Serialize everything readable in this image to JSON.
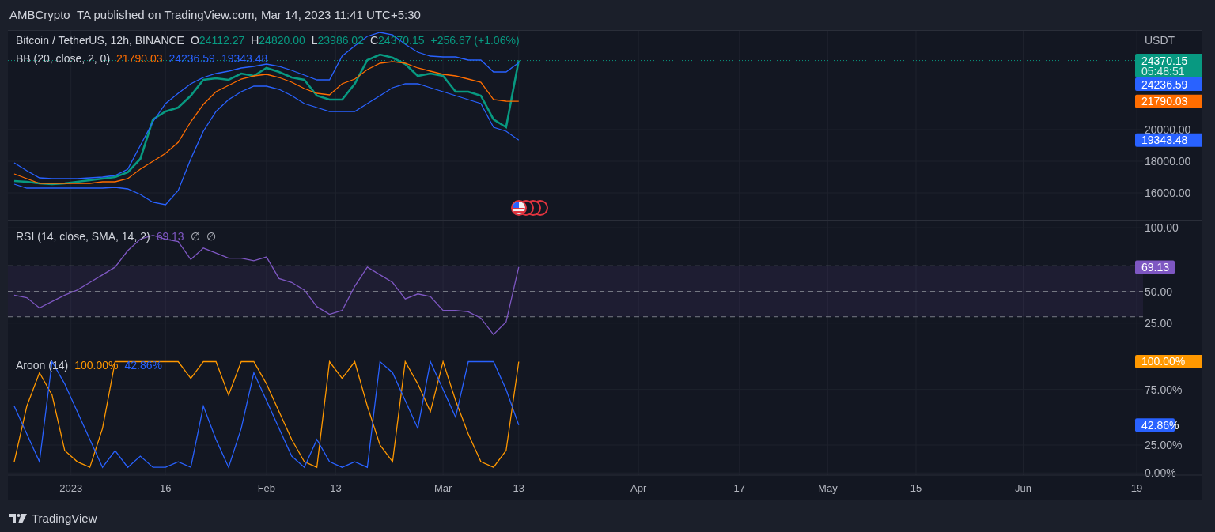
{
  "header": {
    "title": "AMBCrypto_TA published on TradingView.com, Mar 14, 2023 11:41 UTC+5:30"
  },
  "price_pane": {
    "legend": {
      "symbol": "Bitcoin / TetherUS, 12h, BINANCE",
      "ohlc": [
        {
          "label": "O",
          "value": "24112.27"
        },
        {
          "label": "H",
          "value": "24820.00"
        },
        {
          "label": "L",
          "value": "23986.02"
        },
        {
          "label": "C",
          "value": "24370.15"
        }
      ],
      "change": "+256.67 (+1.06%)"
    },
    "indicator_legend": {
      "name": "BB (20, close, 2, 0)",
      "values": [
        {
          "text": "21790.03",
          "color": "#ff6d00"
        },
        {
          "text": "24236.59",
          "color": "#2962ff"
        },
        {
          "text": "19343.48",
          "color": "#2962ff"
        }
      ]
    },
    "axis_unit": "USDT",
    "price_labels": [
      {
        "text": "24370.15",
        "note": "05:48:51"
      },
      {
        "text": "24236.59"
      },
      {
        "text": "21790.03"
      },
      {
        "text": "19343.48"
      }
    ],
    "chart_data": {
      "type": "line",
      "grid": true,
      "categories": [
        null,
        null,
        null,
        null,
        null,
        null,
        null,
        null,
        null,
        null,
        null,
        null,
        null,
        null,
        null,
        null,
        null,
        null,
        null,
        null,
        null,
        null,
        null,
        null,
        null,
        null,
        null,
        null,
        null,
        null,
        null,
        null,
        null,
        null,
        null,
        null,
        null,
        null,
        null,
        null,
        null,
        null,
        null,
        null,
        null,
        null,
        null,
        null,
        null,
        null,
        null,
        null,
        null,
        null,
        null,
        null,
        null,
        null,
        null,
        null,
        null,
        null,
        null,
        null,
        null,
        null,
        null,
        null,
        null,
        null,
        null,
        null,
        null,
        null,
        null,
        null,
        null,
        null,
        null,
        null,
        null,
        null,
        null,
        null,
        null,
        null,
        null,
        null,
        null,
        null
      ],
      "ylim": [
        14300,
        26250
      ],
      "series": [
        {
          "color": "#089981",
          "values": [
            16750,
            16700,
            16600,
            16550,
            16600,
            16700,
            16800,
            16900,
            17000,
            17300,
            18150,
            20650,
            21150,
            21400,
            22150,
            23150,
            23250,
            23150,
            23550,
            23400,
            23900,
            23650,
            23300,
            23150,
            22150,
            21900,
            21900,
            22900,
            24400,
            24750,
            24550,
            24150,
            23400,
            23550,
            23400,
            22400,
            22400,
            22150,
            20650,
            20150,
            24370,
            null,
            null,
            null,
            null,
            null,
            null,
            null,
            null,
            null,
            null,
            null,
            null,
            null,
            null,
            null,
            null,
            null,
            null,
            null,
            null,
            null,
            null,
            null,
            null,
            null,
            null,
            null,
            null,
            null,
            null,
            null,
            null,
            null,
            null,
            null,
            null,
            null,
            null,
            null,
            null,
            null,
            null,
            null,
            null,
            null,
            null,
            null,
            null,
            null
          ]
        },
        {
          "color": "#2962ff",
          "values": [
            17900,
            17400,
            16950,
            16900,
            16900,
            16900,
            16950,
            17000,
            17100,
            17500,
            19000,
            20500,
            21650,
            22300,
            22900,
            23300,
            23550,
            23700,
            23900,
            24000,
            24150,
            24000,
            23750,
            23450,
            23150,
            23150,
            24650,
            25300,
            25900,
            26150,
            26000,
            25400,
            24900,
            24650,
            24600,
            24600,
            24400,
            24400,
            23650,
            23650,
            24240,
            null,
            null,
            null,
            null,
            null,
            null,
            null,
            null,
            null,
            null,
            null,
            null,
            null,
            null,
            null,
            null,
            null,
            null,
            null,
            null,
            null,
            null,
            null,
            null,
            null,
            null,
            null,
            null,
            null,
            null,
            null,
            null,
            null,
            null,
            null,
            null,
            null,
            null,
            null,
            null,
            null,
            null,
            null,
            null,
            null,
            null,
            null,
            null,
            null
          ]
        },
        {
          "color": "#ff6d00",
          "values": [
            17200,
            16900,
            16600,
            16600,
            16600,
            16600,
            16600,
            16700,
            16700,
            16900,
            17500,
            18000,
            18500,
            19200,
            20500,
            21600,
            22400,
            22800,
            23200,
            23400,
            23500,
            23300,
            23000,
            22600,
            22300,
            22200,
            22900,
            23200,
            23800,
            24200,
            24300,
            24200,
            23900,
            23700,
            23500,
            23400,
            23200,
            23000,
            21900,
            21800,
            21790,
            null,
            null,
            null,
            null,
            null,
            null,
            null,
            null,
            null,
            null,
            null,
            null,
            null,
            null,
            null,
            null,
            null,
            null,
            null,
            null,
            null,
            null,
            null,
            null,
            null,
            null,
            null,
            null,
            null,
            null,
            null,
            null,
            null,
            null,
            null,
            null,
            null,
            null,
            null,
            null,
            null,
            null,
            null,
            null,
            null,
            null,
            null,
            null,
            null
          ]
        },
        {
          "color": "#2962ff",
          "values": [
            16550,
            16300,
            16300,
            16300,
            16300,
            16300,
            16300,
            16300,
            16350,
            16250,
            15900,
            15400,
            15250,
            16150,
            18150,
            19900,
            21150,
            21900,
            22400,
            22750,
            22750,
            22550,
            22150,
            21650,
            21400,
            21150,
            21150,
            21150,
            21650,
            22150,
            22650,
            22900,
            22900,
            22650,
            22400,
            22150,
            21900,
            21650,
            20150,
            19900,
            19340,
            null,
            null,
            null,
            null,
            null,
            null,
            null,
            null,
            null,
            null,
            null,
            null,
            null,
            null,
            null,
            null,
            null,
            null,
            null,
            null,
            null,
            null,
            null,
            null,
            null,
            null,
            null,
            null,
            null,
            null,
            null,
            null,
            null,
            null,
            null,
            null,
            null,
            null,
            null,
            null,
            null,
            null,
            null,
            null,
            null,
            null,
            null,
            null,
            null
          ]
        }
      ],
      "yticks": [
        {
          "value": 20000,
          "label": "20000.00"
        },
        {
          "value": 18000,
          "label": "18000.00"
        },
        {
          "value": 16000,
          "label": "16000.00"
        }
      ],
      "ref_lines": [
        {
          "axis": "y",
          "value": 24370,
          "color": "#089981"
        }
      ]
    }
  },
  "rsi_pane": {
    "legend": {
      "name": "RSI (14, close, SMA, 14, 2)",
      "values": [
        {
          "text": "69.13",
          "color": "#7e57c2"
        }
      ],
      "extras": [
        "∅",
        "∅"
      ]
    },
    "price_labels": [
      {
        "text": "69.13"
      }
    ],
    "chart_data": {
      "type": "line",
      "grid": true,
      "categories": [
        null,
        null,
        null,
        null,
        null,
        null,
        null,
        null,
        null,
        null,
        null,
        null,
        null,
        null,
        null,
        null,
        null,
        null,
        null,
        null,
        null,
        null,
        null,
        null,
        null,
        null,
        null,
        null,
        null,
        null,
        null,
        null,
        null,
        null,
        null,
        null,
        null,
        null,
        null,
        null,
        null,
        null,
        null,
        null,
        null,
        null,
        null,
        null,
        null,
        null,
        null,
        null,
        null,
        null,
        null,
        null,
        null,
        null,
        null,
        null,
        null,
        null,
        null,
        null,
        null,
        null,
        null,
        null,
        null,
        null,
        null,
        null,
        null,
        null,
        null,
        null,
        null,
        null,
        null,
        null,
        null,
        null,
        null,
        null,
        null,
        null,
        null,
        null,
        null,
        null
      ],
      "ylim": [
        5,
        105.6
      ],
      "series": [
        {
          "color": "#7e57c2",
          "values": [
            47,
            45,
            37,
            42,
            47,
            51,
            57,
            63,
            69,
            82,
            91,
            94,
            91,
            89,
            75,
            84,
            80,
            76,
            76,
            74,
            77,
            60,
            57,
            51,
            38,
            32,
            35,
            54,
            69,
            63,
            57,
            44,
            48,
            46,
            35,
            35,
            34,
            29,
            16,
            26,
            69,
            null,
            null,
            null,
            null,
            null,
            null,
            null,
            null,
            null,
            null,
            null,
            null,
            null,
            null,
            null,
            null,
            null,
            null,
            null,
            null,
            null,
            null,
            null,
            null,
            null,
            null,
            null,
            null,
            null,
            null,
            null,
            null,
            null,
            null,
            null,
            null,
            null,
            null,
            null,
            null,
            null,
            null,
            null,
            null,
            null,
            null,
            null,
            null,
            null
          ]
        }
      ],
      "yticks": [
        {
          "value": 100,
          "label": "100.00"
        },
        {
          "value": 50,
          "label": "50.00"
        },
        {
          "value": 25,
          "label": "25.00"
        }
      ],
      "bands": [
        {
          "axis": "y",
          "from": 30,
          "to": 70,
          "color": "#7e57c2"
        }
      ],
      "ref_lines": [
        {
          "axis": "y",
          "value": 70
        },
        {
          "axis": "y",
          "value": 50
        },
        {
          "axis": "y",
          "value": 30
        }
      ]
    }
  },
  "aroon_pane": {
    "legend": {
      "name": "Aroon (14)",
      "values": [
        {
          "text": "100.00%",
          "color": "#ff9800"
        },
        {
          "text": "42.86%",
          "color": "#2962ff"
        }
      ]
    },
    "price_labels": [
      {
        "text": "100.00%"
      },
      {
        "text": "42.86%"
      }
    ],
    "chart_data": {
      "type": "line",
      "grid": true,
      "categories": [
        null,
        null,
        null,
        null,
        null,
        null,
        null,
        null,
        null,
        null,
        null,
        null,
        null,
        null,
        null,
        null,
        null,
        null,
        null,
        null,
        null,
        null,
        null,
        null,
        null,
        null,
        null,
        null,
        null,
        null,
        null,
        null,
        null,
        null,
        null,
        null,
        null,
        null,
        null,
        null,
        null,
        null,
        null,
        null,
        null,
        null,
        null,
        null,
        null,
        null,
        null,
        null,
        null,
        null,
        null,
        null,
        null,
        null,
        null,
        null,
        null,
        null,
        null,
        null,
        null,
        null,
        null,
        null,
        null,
        null,
        null,
        null,
        null,
        null,
        null,
        null,
        null,
        null,
        null,
        null,
        null,
        null,
        null,
        null,
        null,
        null,
        null,
        null,
        null,
        null
      ],
      "ylim": [
        -2,
        111
      ],
      "series": [
        {
          "color": "#ff9800",
          "values": [
            10,
            60,
            90,
            70,
            20,
            10,
            5,
            40,
            100,
            100,
            100,
            100,
            100,
            100,
            85,
            100,
            100,
            70,
            100,
            100,
            80,
            55,
            30,
            10,
            5,
            100,
            85,
            100,
            60,
            25,
            10,
            100,
            80,
            55,
            100,
            65,
            35,
            10,
            5,
            20,
            100,
            null,
            null,
            null,
            null,
            null,
            null,
            null,
            null,
            null,
            null,
            null,
            null,
            null,
            null,
            null,
            null,
            null,
            null,
            null,
            null,
            null,
            null,
            null,
            null,
            null,
            null,
            null,
            null,
            null,
            null,
            null,
            null,
            null,
            null,
            null,
            null,
            null,
            null,
            null,
            null,
            null,
            null,
            null,
            null,
            null,
            null,
            null,
            null,
            null
          ]
        },
        {
          "color": "#2962ff",
          "values": [
            60,
            35,
            10,
            100,
            80,
            55,
            30,
            5,
            20,
            5,
            15,
            5,
            5,
            10,
            5,
            60,
            30,
            5,
            40,
            90,
            65,
            40,
            15,
            5,
            30,
            10,
            5,
            10,
            5,
            100,
            90,
            65,
            40,
            100,
            75,
            50,
            100,
            100,
            100,
            75,
            43,
            null,
            null,
            null,
            null,
            null,
            null,
            null,
            null,
            null,
            null,
            null,
            null,
            null,
            null,
            null,
            null,
            null,
            null,
            null,
            null,
            null,
            null,
            null,
            null,
            null,
            null,
            null,
            null,
            null,
            null,
            null,
            null,
            null,
            null,
            null,
            null,
            null,
            null,
            null,
            null,
            null,
            null,
            null,
            null,
            null,
            null,
            null,
            null,
            null
          ]
        }
      ],
      "yticks": [
        {
          "value": 75,
          "label": "75.00%"
        },
        {
          "value": 25,
          "label": "25.00%"
        },
        {
          "value": 0,
          "label": "0.00%"
        }
      ]
    }
  },
  "time_axis": {
    "labels": [
      "2023",
      "16",
      "Feb",
      "13",
      "Mar",
      "13",
      "Apr",
      "17",
      "May",
      "15",
      "Jun",
      "19"
    ]
  },
  "footer": {
    "brand": "TradingView"
  }
}
